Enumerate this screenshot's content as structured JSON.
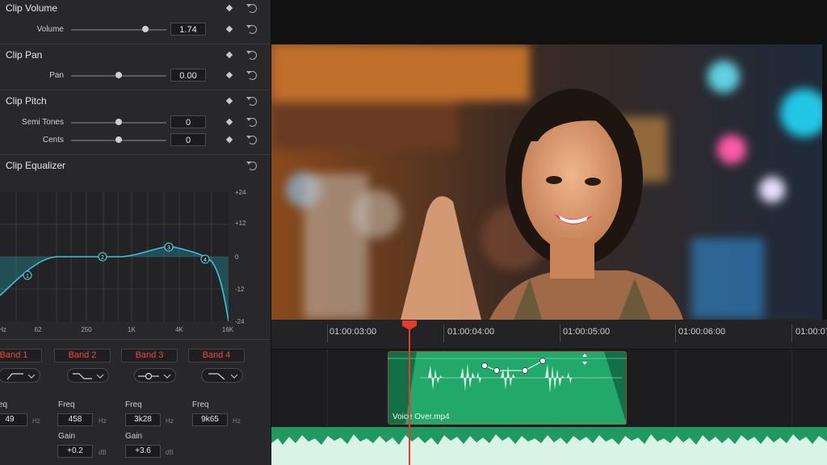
{
  "inspector": {
    "clip_volume": {
      "title": "Clip Volume",
      "param": "Volume",
      "value": "1.74",
      "level": 0.78
    },
    "clip_pan": {
      "title": "Clip Pan",
      "param": "Pan",
      "value": "0.00",
      "level": 0.5
    },
    "clip_pitch": {
      "title": "Clip Pitch",
      "semitones": {
        "param": "Semi Tones",
        "value": "0",
        "level": 0.5
      },
      "cents": {
        "param": "Cents",
        "value": "0",
        "level": 0.5
      }
    },
    "clip_equalizer": {
      "title": "Clip Equalizer",
      "gain_scale": [
        "+24",
        "+12",
        "0",
        "-12",
        "-24"
      ],
      "freq_scale": [
        "Hz",
        "62",
        "250",
        "1K",
        "4K",
        "16K"
      ],
      "nodes": [
        "1",
        "2",
        "3",
        "4"
      ],
      "bands": [
        {
          "label": "Band 1",
          "freq_label": "eq",
          "freq": "49",
          "freq_unit": "Hz"
        },
        {
          "label": "Band 2",
          "freq_label": "Freq",
          "freq": "458",
          "freq_unit": "Hz",
          "gain_label": "Gain",
          "gain": "+0.2",
          "gain_unit": "dB"
        },
        {
          "label": "Band 3",
          "freq_label": "Freq",
          "freq": "3k28",
          "freq_unit": "Hz",
          "gain_label": "Gain",
          "gain": "+3.6",
          "gain_unit": "dB"
        },
        {
          "label": "Band 4",
          "freq_label": "Freq",
          "freq": "9k65",
          "freq_unit": "Hz"
        }
      ]
    }
  },
  "timeline": {
    "timecodes": [
      "01:00:03:00",
      "01:00:04:00",
      "01:00:05:00",
      "01:00:06:00",
      "01:00:07"
    ],
    "clip_name": "Voice Over.mp4"
  },
  "colors": {
    "accent": "#e33b2d",
    "clip": "#1e9e63",
    "band_label": "#f04a3a"
  }
}
